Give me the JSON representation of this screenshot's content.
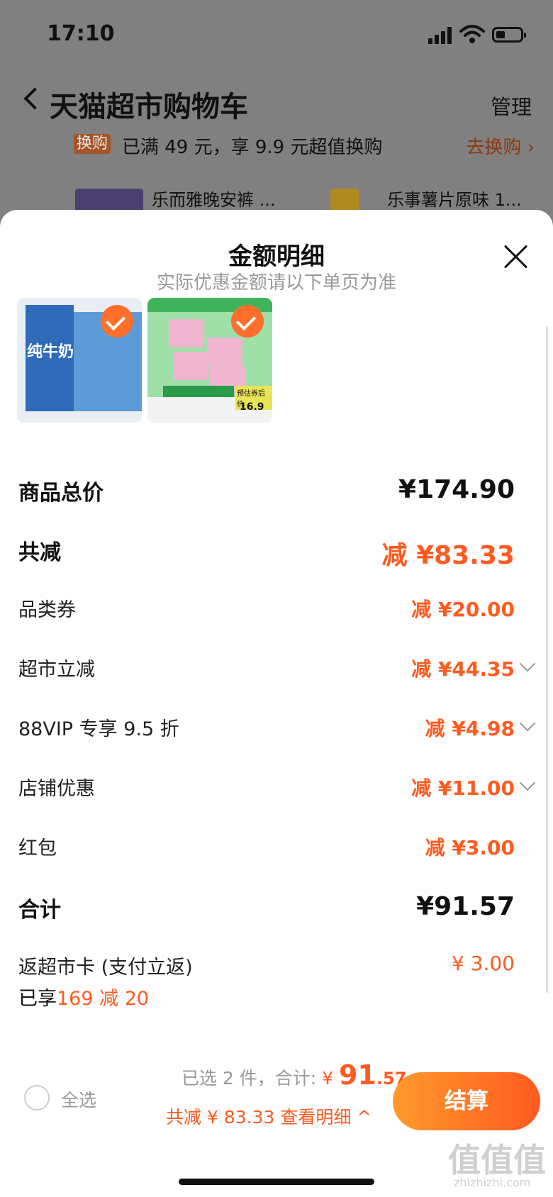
{
  "status_bar": {
    "time": "17:10"
  },
  "header": {
    "title": "天猫超市购物车",
    "manage": "管理"
  },
  "promo": {
    "badge": "换购",
    "text": "已满 49 元，享 9.9 元超值换购",
    "link": "去换购 ›"
  },
  "cart_preview": [
    {
      "name": "乐而雅晚安裤 ..."
    },
    {
      "name": "乐事薯片原味 1..."
    }
  ],
  "sheet": {
    "title": "金额明细",
    "subtitle": "实际优惠金额请以下单页为准",
    "products": [
      {
        "label": "纯牛奶",
        "checked": true
      },
      {
        "label": "16.9",
        "label2": "预估券后价",
        "checked": true
      }
    ],
    "rows": [
      {
        "label": "商品总价",
        "value": "¥174.90",
        "big": true
      },
      {
        "label": "共减",
        "value": "减 ¥83.33",
        "big": true
      },
      {
        "label": "品类券",
        "value": "减 ¥20.00"
      },
      {
        "label": "超市立减",
        "value": "减 ¥44.35",
        "expand": true
      },
      {
        "label": "88VIP 专享 9.5 折",
        "value": "减 ¥4.98",
        "expand": true
      },
      {
        "label": "店铺优惠",
        "value": "减 ¥11.00",
        "expand": true
      },
      {
        "label": "红包",
        "value": "减 ¥3.00"
      },
      {
        "label": "合计",
        "value": "¥91.57",
        "big": true
      },
      {
        "label": "返超市卡 (支付立返)",
        "value": "¥ 3.00"
      }
    ]
  },
  "footer": {
    "enjoyed_prefix": "已享",
    "enjoyed_deal": "169 减 20",
    "select_all": "全选",
    "selected_text": "已选 2 件，合计: ",
    "currency": "¥ ",
    "total_main": "91",
    "total_cents": ".57",
    "reduced": "共减 ¥ 83.33  查看明细 ^",
    "checkout": "结算"
  },
  "watermark": {
    "text": "值值值",
    "domain": "zhizhizhi.com"
  },
  "colors": {
    "accent": "#ff5a1f"
  }
}
